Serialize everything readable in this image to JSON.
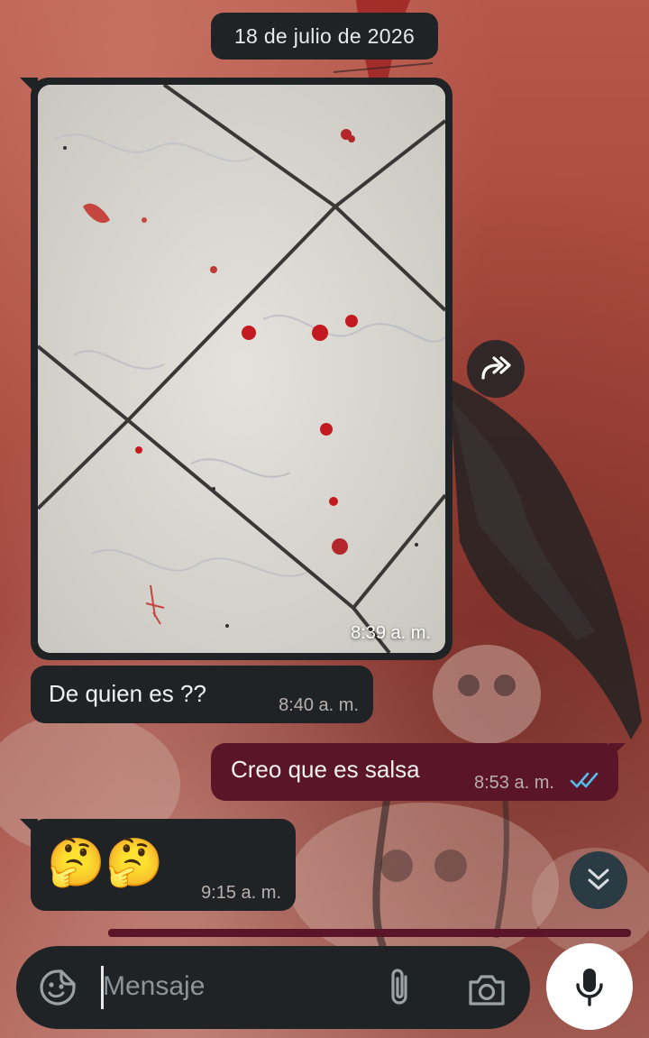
{
  "chat": {
    "date_separator": "18 de julio de 2026",
    "messages": [
      {
        "direction": "incoming",
        "kind": "image",
        "time": "8:39 a. m."
      },
      {
        "direction": "incoming",
        "kind": "text",
        "text": "De quien es  ??",
        "time": "8:40 a. m."
      },
      {
        "direction": "outgoing",
        "kind": "text",
        "text": "Creo que es salsa",
        "time": "8:53 a. m.",
        "status": "read"
      },
      {
        "direction": "incoming",
        "kind": "emoji",
        "text": "🤔🤔",
        "time": "9:15 a. m."
      }
    ]
  },
  "composer": {
    "placeholder": "Mensaje"
  },
  "icons": {
    "emoji": "sticker-icon",
    "attach": "paperclip-icon",
    "camera": "camera-icon",
    "mic": "microphone-icon",
    "forward": "forward-icon",
    "scroll": "double-chevron-down-icon",
    "read_receipt": "double-check-icon"
  },
  "colors": {
    "incoming_bubble": "#1f2326",
    "outgoing_bubble": "#5b1528",
    "read_check": "#53bdeb",
    "scroll_button": "#2b3b44"
  }
}
